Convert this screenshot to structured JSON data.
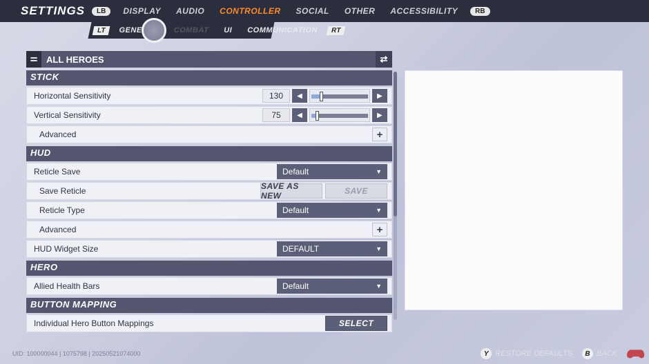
{
  "header": {
    "title": "SETTINGS",
    "lb": "LB",
    "rb": "RB",
    "tabs": [
      "DISPLAY",
      "AUDIO",
      "CONTROLLER",
      "SOCIAL",
      "OTHER",
      "ACCESSIBILITY"
    ],
    "active_tab": "CONTROLLER"
  },
  "subheader": {
    "lt": "LT",
    "rt": "RT",
    "tabs": [
      "GENERAL",
      "COMBAT",
      "UI",
      "COMMUNICATION"
    ],
    "highlighted": "COMBAT"
  },
  "hero_selector": {
    "label": "ALL HEROES"
  },
  "sections": {
    "stick": {
      "title": "STICK",
      "horizontal": {
        "label": "Horizontal Sensitivity",
        "value": "130",
        "pct": 16
      },
      "vertical": {
        "label": "Vertical Sensitivity",
        "value": "75",
        "pct": 9
      },
      "advanced": {
        "label": "Advanced"
      }
    },
    "hud": {
      "title": "HUD",
      "reticle_save": {
        "label": "Reticle Save",
        "value": "Default"
      },
      "save_reticle": {
        "label": "Save Reticle",
        "btn_new": "SAVE AS NEW",
        "btn_save": "SAVE"
      },
      "reticle_type": {
        "label": "Reticle Type",
        "value": "Default"
      },
      "advanced": {
        "label": "Advanced"
      },
      "widget_size": {
        "label": "HUD Widget Size",
        "value": "DEFAULT"
      }
    },
    "hero": {
      "title": "HERO",
      "allied_hp": {
        "label": "Allied Health Bars",
        "value": "Default"
      }
    },
    "button_map": {
      "title": "BUTTON MAPPING",
      "individual": {
        "label": "Individual Hero Button Mappings",
        "btn": "SELECT"
      }
    }
  },
  "footer": {
    "uid": "UID: 100000044 | 1075798 | 20250521074000",
    "restore": {
      "key": "Y",
      "label": "RESTORE DEFAULTS"
    },
    "back": {
      "key": "B",
      "label": "BACK"
    }
  }
}
